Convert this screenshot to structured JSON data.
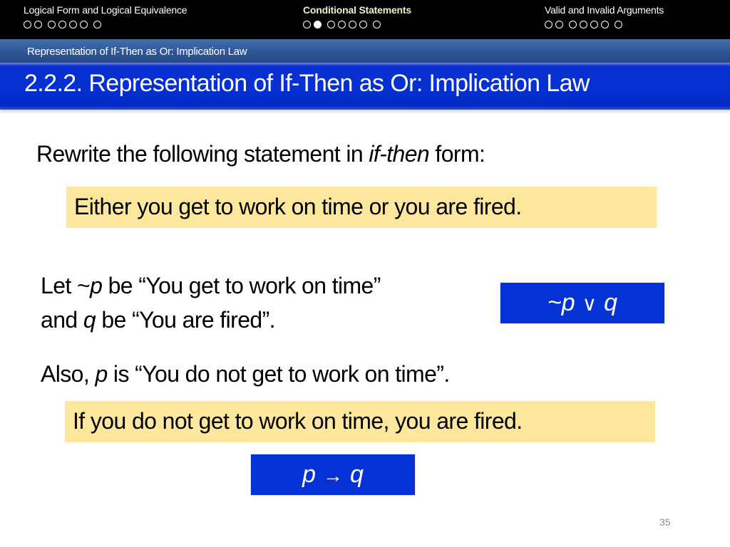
{
  "nav": {
    "sections": [
      {
        "title": "Logical Form and Logical Equivalence",
        "active": false,
        "dots": [
          0,
          0,
          0,
          0,
          0,
          0,
          0
        ]
      },
      {
        "title": "Conditional Statements",
        "active": true,
        "dots": [
          0,
          1,
          0,
          0,
          0,
          0,
          0
        ]
      },
      {
        "title": "Valid and Invalid Arguments",
        "active": false,
        "dots": [
          0,
          0,
          0,
          0,
          0,
          0,
          0
        ]
      }
    ]
  },
  "subtitle": "Representation of If-Then as Or: Implication Law",
  "title": "2.2.2. Representation of If-Then as Or: Implication Law",
  "content": {
    "instruction": {
      "before": "Rewrite the following statement in ",
      "italic": "if-then",
      "after": " form:"
    },
    "statement": "Either you get to work on time or you are fired.",
    "let_line1": {
      "a": "Let ~",
      "var": "p",
      "b": " be “You get to work on time”"
    },
    "let_line2": {
      "a": "and ",
      "var": "q",
      "b": " be “You are fired”."
    },
    "also_line": {
      "a": "Also, ",
      "var": "p",
      "b": " is “You do not get to work on time”."
    },
    "answer": "If you do not get to work on time, you are fired.",
    "formula_or": {
      "left": "~p",
      "op": "∨",
      "right": "q"
    },
    "formula_implies": {
      "left": "p",
      "op": "→",
      "right": "q"
    }
  },
  "colors": {
    "nav_bg": "#000000",
    "title_blue": "#0530d2",
    "highlight_yellow": "#fde79c",
    "active_nav": "#f2eeca"
  },
  "page_number": "35"
}
